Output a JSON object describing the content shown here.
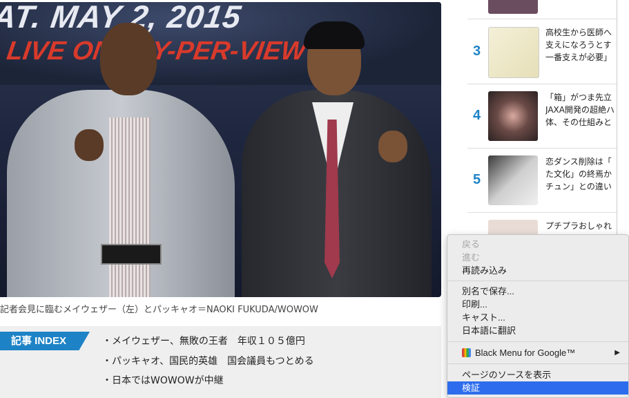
{
  "photo": {
    "banner_line1": "AT. MAY 2, 2015",
    "banner_line2": "LIVE ON PAY-PER-VIEW",
    "caption": "記者会見に臨むメイウェザー（左）とパッキャオ＝NAOKI FUKUDA/WOWOW"
  },
  "article_index": {
    "tag": "記事 INDEX",
    "items": [
      "・メイウェザー、無敗の王者　年収１０５億円",
      "・パッキャオ、国民的英雄　国会議員もつとめる",
      "・日本ではWOWOWが中継"
    ]
  },
  "ranking": [
    {
      "num": "3",
      "lines": [
        "高校生から医師へ",
        "支えになろうとす",
        "一番支えが必要」"
      ]
    },
    {
      "num": "4",
      "lines": [
        "「箱」がつま先立",
        "JAXA開発の超絶ハ",
        "体、その仕組みと"
      ]
    },
    {
      "num": "5",
      "lines": [
        "恋ダンス削除は「",
        "た文化」の終焉か",
        "チュン」との違い"
      ]
    },
    {
      "num": "",
      "lines": [
        "プチプラおしゃれ"
      ]
    }
  ],
  "context_menu": {
    "back": "戻る",
    "forward": "進む",
    "reload": "再読み込み",
    "save_as": "別名で保存...",
    "print": "印刷...",
    "cast": "キャスト...",
    "translate": "日本語に翻訳",
    "extension": "Black Menu for Google™",
    "view_source": "ページのソースを表示",
    "inspect": "検証"
  }
}
